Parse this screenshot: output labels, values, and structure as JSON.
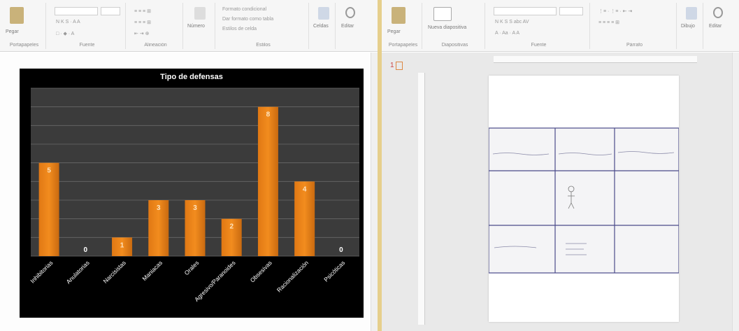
{
  "left_ribbon": {
    "groups": [
      "Portapapeles",
      "Fuente",
      "Alineación",
      "Número",
      "Estilos",
      "Celdas",
      "Editar"
    ],
    "paste_label": "Pegar",
    "number_button": "Número",
    "cells_button": "Celdas",
    "edit_button": "Editar",
    "styles_items": [
      "Formato condicional",
      "Dar formato como tabla",
      "Estilos de celda"
    ]
  },
  "right_ribbon": {
    "groups": [
      "Portapapeles",
      "Diapositivas",
      "Fuente",
      "Párrafo"
    ],
    "paste_label": "Pegar",
    "new_slide_label": "Nueva diapositiva",
    "draw_button": "Dibujo",
    "edit_button": "Editar"
  },
  "slide_panel": {
    "number": "1"
  },
  "chart_data": {
    "type": "bar",
    "title": "Tipo de defensas",
    "categories": [
      "Inhibitorias",
      "Anulatorias",
      "Narcisistas",
      "Maniacas",
      "Orales",
      "Agresivo/Paranoides",
      "Obsesivas",
      "Racionalización",
      "Psicóticas"
    ],
    "values": [
      5,
      0,
      1,
      3,
      3,
      2,
      8,
      4,
      0
    ],
    "ylim": [
      0,
      9
    ],
    "grid": true,
    "bar_color": "#f28c1e",
    "background": "#000000",
    "plot_background": "#3b3b3b"
  }
}
